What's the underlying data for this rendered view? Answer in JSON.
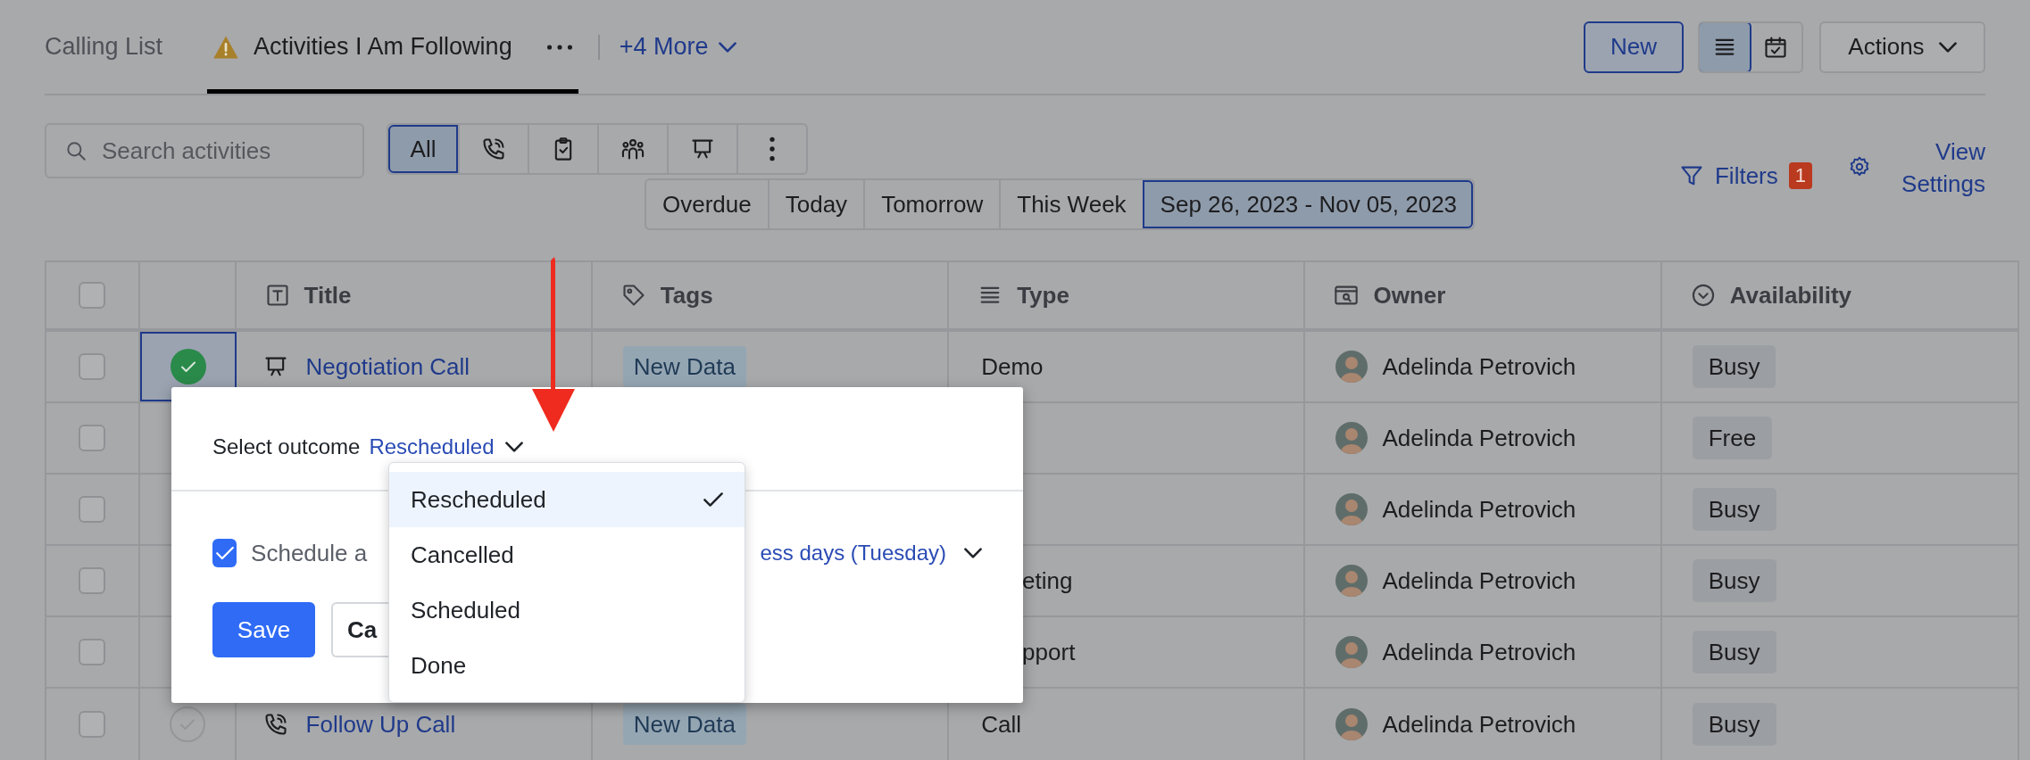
{
  "tabs": [
    {
      "label": "Calling List",
      "selected": false,
      "warning": false,
      "menu": false
    },
    {
      "label": "Activities I Am Following",
      "selected": true,
      "warning": true,
      "menu": true
    }
  ],
  "more_tabs": "+4 More",
  "new_button": "New",
  "view_toggle": [
    {
      "kind": "list",
      "selected": true
    },
    {
      "kind": "calendar",
      "selected": false
    }
  ],
  "actions_button": "Actions",
  "search": {
    "placeholder": "Search activities"
  },
  "type_filters": [
    {
      "kind": "all",
      "label": "All",
      "selected": true
    },
    {
      "kind": "call",
      "selected": false
    },
    {
      "kind": "task",
      "selected": false
    },
    {
      "kind": "meeting",
      "selected": false
    },
    {
      "kind": "demo",
      "selected": false
    },
    {
      "kind": "more",
      "selected": false
    }
  ],
  "date_filters": [
    {
      "label": "Overdue",
      "selected": false
    },
    {
      "label": "Today",
      "selected": false
    },
    {
      "label": "Tomorrow",
      "selected": false
    },
    {
      "label": "This Week",
      "selected": false
    },
    {
      "label": "Sep 26, 2023 - Nov 05, 2023",
      "selected": true
    }
  ],
  "filters": {
    "label": "Filters",
    "count": "1"
  },
  "view_settings": "View Settings",
  "table": {
    "header_checked": false,
    "columns": [
      {
        "kind": "text",
        "label": "Title"
      },
      {
        "kind": "tag",
        "label": "Tags"
      },
      {
        "kind": "list",
        "label": "Type"
      },
      {
        "kind": "owner",
        "label": "Owner"
      },
      {
        "kind": "select",
        "label": "Availability"
      }
    ],
    "rows": [
      {
        "checked": false,
        "status": {
          "done": true,
          "selected": true
        },
        "title": {
          "kind": "demo",
          "text": "Negotiation Call"
        },
        "tag": "New Data",
        "type": "Demo",
        "owner": "Adelinda Petrovich",
        "availability": "Busy"
      },
      {
        "checked": false,
        "owner": "Adelinda Petrovich",
        "availability": "Free"
      },
      {
        "checked": false,
        "owner": "Adelinda Petrovich",
        "availability": "Busy"
      },
      {
        "checked": false,
        "type": "eting",
        "owner": "Adelinda Petrovich",
        "availability": "Busy"
      },
      {
        "checked": false,
        "type": "pport",
        "owner": "Adelinda Petrovich",
        "availability": "Busy"
      },
      {
        "checked": false,
        "status": {
          "done": false,
          "selected": false
        },
        "title": {
          "kind": "call",
          "text": "Follow Up Call"
        },
        "tag": "New Data",
        "type": "Call",
        "owner": "Adelinda Petrovich",
        "availability": "Busy"
      }
    ]
  },
  "outcome_popover": {
    "label": "Select outcome",
    "value": "Rescheduled",
    "options": [
      {
        "label": "Rescheduled",
        "selected": true
      },
      {
        "label": "Cancelled",
        "selected": false
      },
      {
        "label": "Scheduled",
        "selected": false
      },
      {
        "label": "Done",
        "selected": false
      }
    ],
    "follow_up": {
      "checked": true,
      "label": "Schedule a",
      "value": "ess days (Tuesday)"
    },
    "buttons": [
      {
        "kind": "primary",
        "label": "Save"
      },
      {
        "kind": "secondary",
        "label": "Ca"
      }
    ]
  }
}
